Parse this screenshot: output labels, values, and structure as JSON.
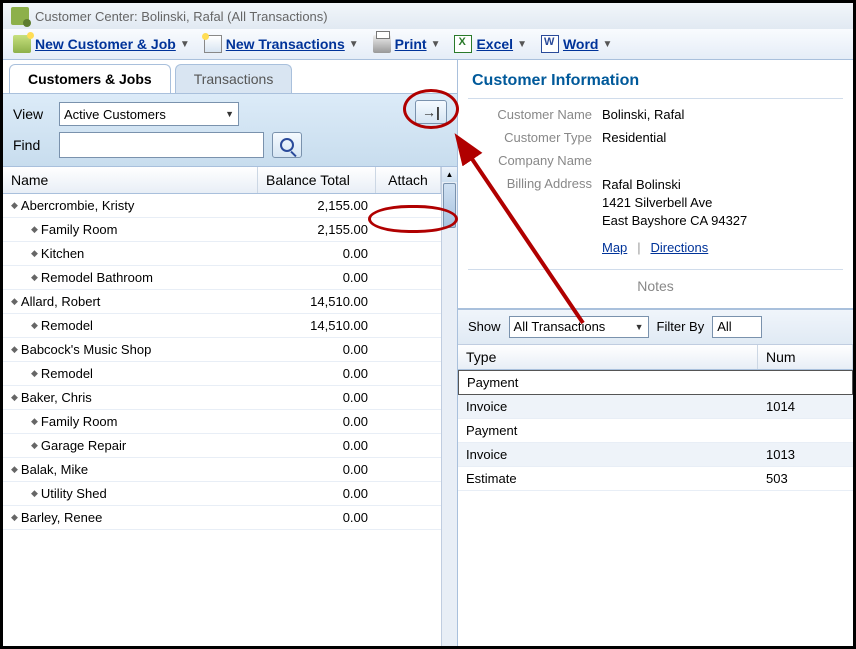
{
  "window": {
    "title": "Customer Center: Bolinski, Rafal (All Transactions)"
  },
  "toolbar": {
    "new_customer": "New Customer & Job",
    "new_tx": "New Transactions",
    "print": "Print",
    "excel": "Excel",
    "word": "Word"
  },
  "tabs": {
    "customers": "Customers & Jobs",
    "transactions": "Transactions"
  },
  "filters": {
    "view_label": "View",
    "view_value": "Active Customers",
    "find_label": "Find",
    "find_value": ""
  },
  "list": {
    "head_name": "Name",
    "head_balance": "Balance Total",
    "head_attach": "Attach",
    "rows": [
      {
        "name": "Abercrombie, Kristy",
        "balance": "2,155.00",
        "level": 0
      },
      {
        "name": "Family Room",
        "balance": "2,155.00",
        "level": 1
      },
      {
        "name": "Kitchen",
        "balance": "0.00",
        "level": 1
      },
      {
        "name": "Remodel Bathroom",
        "balance": "0.00",
        "level": 1
      },
      {
        "name": "Allard, Robert",
        "balance": "14,510.00",
        "level": 0
      },
      {
        "name": "Remodel",
        "balance": "14,510.00",
        "level": 1
      },
      {
        "name": "Babcock's Music Shop",
        "balance": "0.00",
        "level": 0
      },
      {
        "name": "Remodel",
        "balance": "0.00",
        "level": 1
      },
      {
        "name": "Baker, Chris",
        "balance": "0.00",
        "level": 0
      },
      {
        "name": "Family Room",
        "balance": "0.00",
        "level": 1
      },
      {
        "name": "Garage Repair",
        "balance": "0.00",
        "level": 1
      },
      {
        "name": "Balak, Mike",
        "balance": "0.00",
        "level": 0
      },
      {
        "name": "Utility Shed",
        "balance": "0.00",
        "level": 1
      },
      {
        "name": "Barley, Renee",
        "balance": "0.00",
        "level": 0
      }
    ]
  },
  "info": {
    "heading": "Customer Information",
    "labels": {
      "name": "Customer Name",
      "type": "Customer Type",
      "company": "Company Name",
      "billing": "Billing Address"
    },
    "name": "Bolinski, Rafal",
    "type": "Residential",
    "company": "",
    "addr1": "Rafal Bolinski",
    "addr2": "1421 Silverbell Ave",
    "addr3": "East Bayshore CA 94327",
    "map": "Map",
    "directions": "Directions",
    "notes": "Notes"
  },
  "tx": {
    "show_label": "Show",
    "show_value": "All Transactions",
    "filter_label": "Filter By",
    "filter_value": "All",
    "head_type": "Type",
    "head_num": "Num",
    "rows": [
      {
        "type": "Payment",
        "num": ""
      },
      {
        "type": "Invoice",
        "num": "1014"
      },
      {
        "type": "Payment",
        "num": ""
      },
      {
        "type": "Invoice",
        "num": "1013"
      },
      {
        "type": "Estimate",
        "num": "503"
      }
    ]
  }
}
